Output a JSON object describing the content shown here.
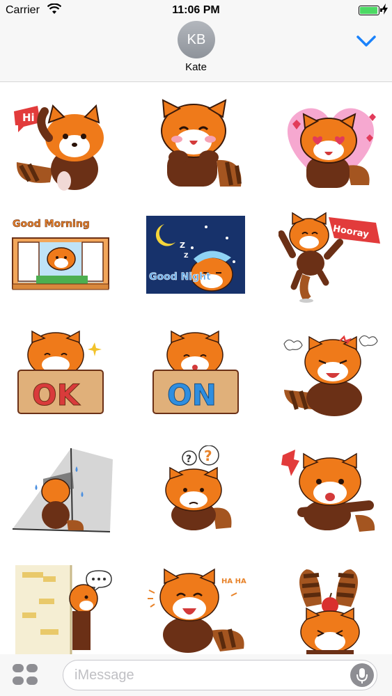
{
  "status_bar": {
    "carrier": "Carrier",
    "time": "11:06 PM",
    "battery_level": 0.9,
    "wifi_icon": "wifi-icon",
    "charging_icon": "bolt-icon"
  },
  "header": {
    "avatar_initials": "KB",
    "contact_name": "Kate",
    "collapse_icon": "chevron-down-icon",
    "accent_color": "#1a82fb"
  },
  "stickers": [
    {
      "name": "hi-wave",
      "caption": "Hi"
    },
    {
      "name": "happy-cheeks",
      "caption": ""
    },
    {
      "name": "heart-eyes",
      "caption": ""
    },
    {
      "name": "good-morning-window",
      "caption": "Good Morning"
    },
    {
      "name": "good-night-sleepy",
      "caption": "Good Night"
    },
    {
      "name": "hooray-jump",
      "caption": "Hooray"
    },
    {
      "name": "ok-sign",
      "caption": "OK"
    },
    {
      "name": "on-sign",
      "caption": "ON"
    },
    {
      "name": "angry-fume",
      "caption": ""
    },
    {
      "name": "gloomy-corner",
      "caption": ""
    },
    {
      "name": "confused-question",
      "caption": ""
    },
    {
      "name": "shocked-point",
      "caption": ""
    },
    {
      "name": "peek-wall",
      "caption": ""
    },
    {
      "name": "laughing-haha",
      "caption": "HA HA"
    },
    {
      "name": "apple-balance",
      "caption": ""
    }
  ],
  "input_bar": {
    "placeholder": "iMessage",
    "value": "",
    "apps_icon": "apps-icon",
    "mic_icon": "microphone-icon"
  }
}
